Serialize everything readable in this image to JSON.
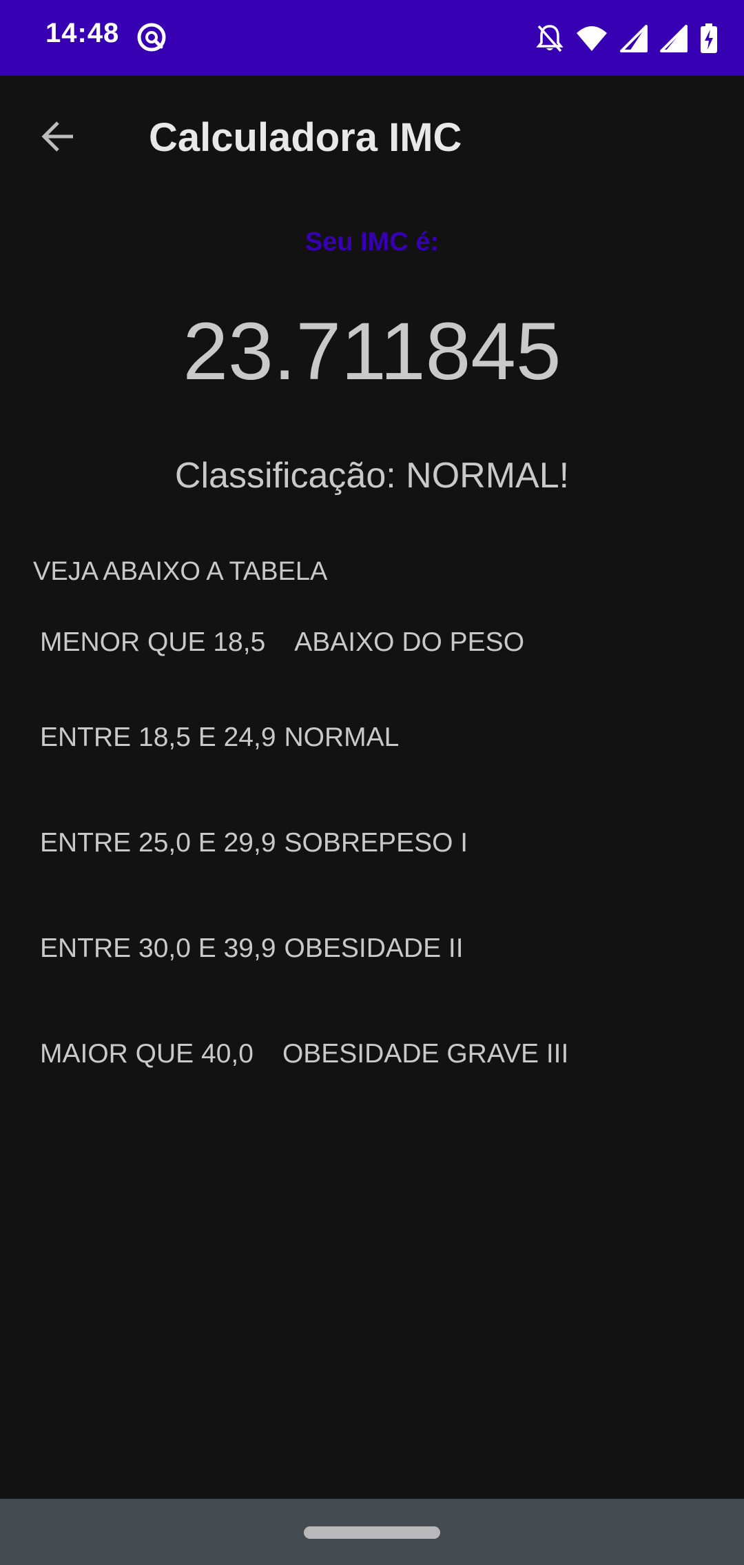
{
  "status_bar": {
    "time": "14:48",
    "background": "#3700b3",
    "icons": [
      "notification-app-icon",
      "notifications-off-icon",
      "wifi-icon",
      "cell-signal-icon",
      "cell-signal-icon",
      "battery-charging-icon"
    ]
  },
  "app_bar": {
    "title": "Calculadora IMC",
    "back_icon": "arrow-back-icon"
  },
  "result": {
    "label": "Seu IMC é:",
    "label_color": "#3700b3",
    "value": "23.711845",
    "classification_label": "Classificação: ",
    "classification_value": "NORMAL!"
  },
  "table": {
    "heading": "VEJA ABAIXO A TABELA",
    "rows": [
      {
        "range": "MENOR QUE 18,5",
        "category": "ABAIXO DO PESO"
      },
      {
        "range": "ENTRE 18,5 E 24,9",
        "category": "NORMAL"
      },
      {
        "range": "ENTRE 25,0 E 29,9",
        "category": "SOBREPESO I"
      },
      {
        "range": "ENTRE 30,0 E 39,9",
        "category": "OBESIDADE II"
      },
      {
        "range": "MAIOR QUE 40,0",
        "category": "OBESIDADE GRAVE III"
      }
    ]
  },
  "nav_bar": {
    "background": "#434a50",
    "handle_icon": "home-gesture-handle"
  }
}
